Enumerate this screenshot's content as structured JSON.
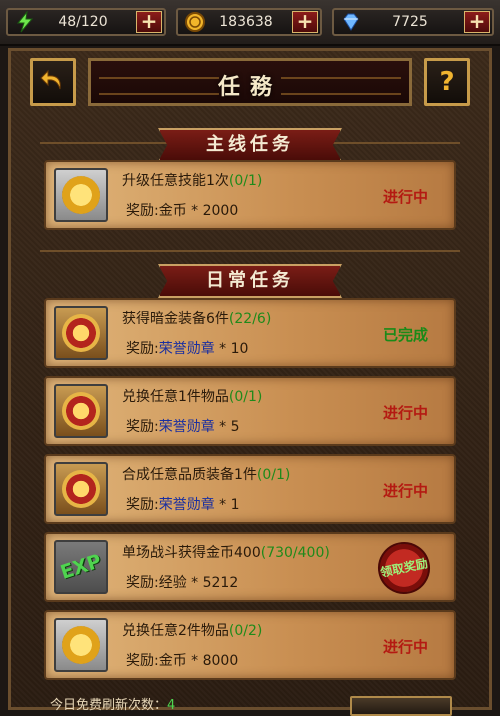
{
  "resources": {
    "energy": "48/120",
    "gold": "183638",
    "diamond": "7725",
    "plus_label": "+"
  },
  "header": {
    "title": "任務",
    "back_icon": "back-arrow-icon",
    "help_label": "?"
  },
  "sections": {
    "main": "主线任务",
    "daily": "日常任务"
  },
  "quests": [
    {
      "title": "升级任意技能1次",
      "progress": "(0/1)",
      "reward_label": "奖励:",
      "reward_name": "金币",
      "reward_amount": " * 2000",
      "status": "进行中",
      "icon": "coin-icon"
    },
    {
      "title": "获得暗金装备6件",
      "progress": "(22/6)",
      "reward_label": "奖励:",
      "reward_name": "荣誉勋章",
      "reward_amount": " * 10",
      "status": "已完成",
      "icon": "medal-icon"
    },
    {
      "title": "兑换任意1件物品",
      "progress": "(0/1)",
      "reward_label": "奖励:",
      "reward_name": "荣誉勋章",
      "reward_amount": " * 5",
      "status": "进行中",
      "icon": "medal-icon"
    },
    {
      "title": "合成任意品质装备1件",
      "progress": "(0/1)",
      "reward_label": "奖励:",
      "reward_name": "荣誉勋章",
      "reward_amount": " * 1",
      "status": "进行中",
      "icon": "medal-icon"
    },
    {
      "title": "单场战斗获得金币400",
      "progress": "(730/400)",
      "reward_label": "奖励:",
      "reward_name": "经验",
      "reward_amount": " * 5212",
      "status": "领取奖励",
      "icon": "exp-icon",
      "exp_text": "EXP"
    },
    {
      "title": "兑换任意2件物品",
      "progress": "(0/2)",
      "reward_label": "奖励:",
      "reward_name": "金币",
      "reward_amount": " * 8000",
      "status": "进行中",
      "icon": "coin-icon"
    }
  ],
  "footer": {
    "refresh_label": "今日免费刷新次数：",
    "refresh_count": "4"
  }
}
